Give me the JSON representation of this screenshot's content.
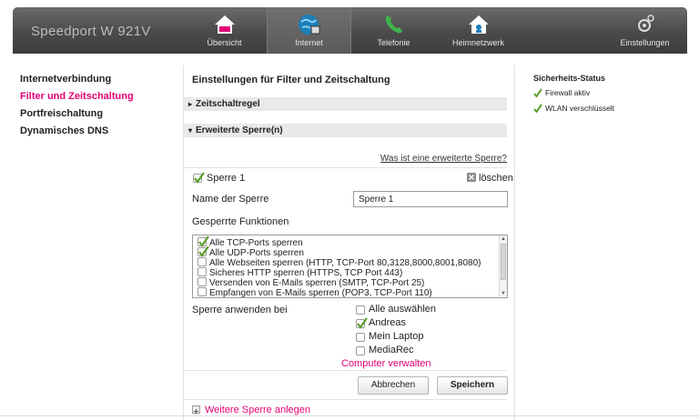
{
  "header": {
    "brand": "Speedport W 921V",
    "nav": [
      {
        "label": "Übersicht",
        "icon": "home-icon"
      },
      {
        "label": "Internet",
        "icon": "globe-icon",
        "active": true
      },
      {
        "label": "Telefonie",
        "icon": "phone-icon"
      },
      {
        "label": "Heimnetzwerk",
        "icon": "home-network-icon"
      },
      {
        "label": "Einstellungen",
        "icon": "gear-icon"
      }
    ]
  },
  "sidebar": {
    "items": [
      {
        "label": "Internetverbindung"
      },
      {
        "label": "Filter und Zeitschaltung",
        "current": true
      },
      {
        "label": "Portfreischaltung"
      },
      {
        "label": "Dynamisches DNS"
      }
    ]
  },
  "main": {
    "title": "Einstellungen für Filter und Zeitschaltung",
    "section_time": "Zeitschaltregel",
    "section_extended": "Erweiterte Sperre(n)",
    "help_link": "Was ist eine erweiterte Sperre?",
    "rule": {
      "enabled_label": "Sperre 1",
      "delete_label": "löschen",
      "name_label": "Name der Sperre",
      "name_value": "Sperre 1",
      "functions_label": "Gesperrte Funktionen",
      "functions": [
        {
          "label": "Alle TCP-Ports sperren",
          "checked": true
        },
        {
          "label": "Alle UDP-Ports sperren",
          "checked": true
        },
        {
          "label": "Alle Webseiten sperren (HTTP, TCP-Port 80,3128,8000,8001,8080)",
          "checked": false
        },
        {
          "label": "Sicheres HTTP sperren (HTTPS, TCP Port 443)",
          "checked": false
        },
        {
          "label": "Versenden von E-Mails sperren (SMTP, TCP-Port 25)",
          "checked": false
        },
        {
          "label": "Empfangen von E-Mails sperren (POP3, TCP-Port 110)",
          "checked": false
        }
      ],
      "apply_label": "Sperre anwenden bei",
      "devices": [
        {
          "label": "Alle auswählen",
          "checked": false
        },
        {
          "label": "Andreas",
          "checked": true
        },
        {
          "label": "Mein Laptop",
          "checked": false
        },
        {
          "label": "MediaRec",
          "checked": false
        }
      ],
      "manage_link": "Computer verwalten",
      "cancel_label": "Abbrechen",
      "save_label": "Speichern"
    },
    "add_rule": "Weitere Sperre anlegen"
  },
  "status": {
    "title": "Sicherheits-Status",
    "items": [
      {
        "label": "Firewall aktiv"
      },
      {
        "label": "WLAN verschlüsselt"
      }
    ]
  },
  "colors": {
    "accent": "#e20074",
    "check_green": "#5aa02c",
    "header_dark": "#4a4a4a"
  }
}
